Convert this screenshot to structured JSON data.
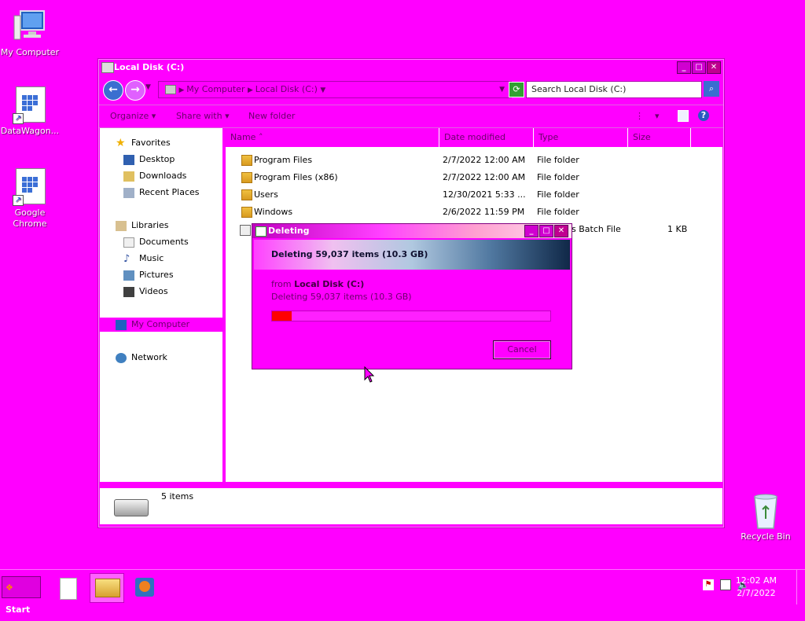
{
  "desktop": {
    "icons": [
      {
        "label": "My Computer"
      },
      {
        "label": "DataWagon..."
      },
      {
        "label": "Google Chrome"
      },
      {
        "label": "Recycle Bin"
      }
    ]
  },
  "explorer": {
    "title": "Local Disk (C:)",
    "address": {
      "crumbs": [
        "My Computer",
        "Local Disk (C:)"
      ]
    },
    "search_placeholder": "Search Local Disk (C:)",
    "toolbar": {
      "organize": "Organize",
      "share_with": "Share with",
      "new_folder": "New folder"
    },
    "nav": {
      "favorites": {
        "label": "Favorites",
        "items": [
          "Desktop",
          "Downloads",
          "Recent Places"
        ]
      },
      "libraries": {
        "label": "Libraries",
        "items": [
          "Documents",
          "Music",
          "Pictures",
          "Videos"
        ]
      },
      "computer": "My Computer",
      "network": "Network"
    },
    "columns": [
      "Name",
      "Date modified",
      "Type",
      "Size"
    ],
    "files": [
      {
        "name": "Program Files",
        "date": "2/7/2022 12:00 AM",
        "type": "File folder",
        "size": ""
      },
      {
        "name": "Program Files (x86)",
        "date": "2/7/2022 12:00 AM",
        "type": "File folder",
        "size": ""
      },
      {
        "name": "Users",
        "date": "12/30/2021 5:33 ...",
        "type": "File folder",
        "size": ""
      },
      {
        "name": "Windows",
        "date": "2/6/2022 11:59 PM",
        "type": "File folder",
        "size": ""
      },
      {
        "name": "",
        "date": "",
        "type": "s Batch File",
        "size": "1 KB"
      }
    ],
    "status": {
      "count": "5 items"
    }
  },
  "dialog": {
    "title": "Deleting",
    "header": "Deleting 59,037 items (10.3 GB)",
    "from_label": "from",
    "from_value": "Local Disk (C:)",
    "detail": "Deleting 59,037 items (10.3 GB)",
    "progress_fraction": 0.07,
    "cancel": "Cancel"
  },
  "taskbar": {
    "start": "Start",
    "time": "12:02 AM",
    "date": "2/7/2022"
  },
  "colors": {
    "desktop": "#ff00ff",
    "progress": "#ff0000"
  }
}
